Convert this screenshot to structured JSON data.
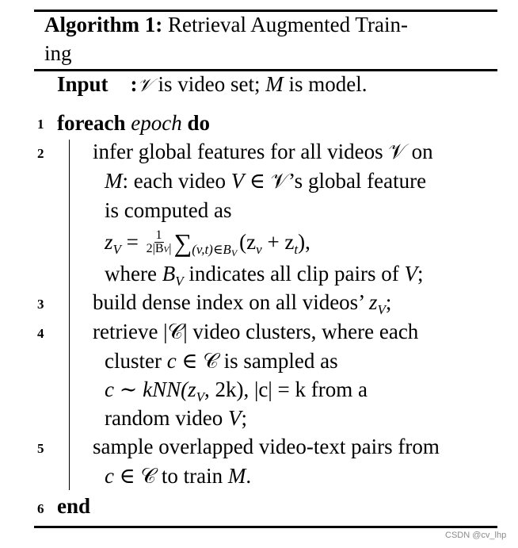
{
  "algorithm": {
    "label": "Algorithm 1:",
    "title_line1": "Retrieval Augmented Train-",
    "title_line2": "ing",
    "input_label": "Input",
    "input_sep": ":",
    "input_text": {
      "v_set": "𝒱",
      "part1": " is video set; ",
      "M": "M",
      "part2": " is model."
    }
  },
  "lines": [
    {
      "num": "1",
      "kw1": "foreach",
      "var": "epoch",
      "kw2": "do"
    },
    {
      "num": "2",
      "l1": "infer global features for all videos 𝒱 on",
      "l2_M": "M",
      "l2": ": each video ",
      "l2_V": "V",
      "l2_b": " ∈ 𝒱’s global feature",
      "l3": "is computed as",
      "formula_lhs": "z",
      "formula_lhs_sub": "V",
      "formula_eq": " = ",
      "frac_num": "1",
      "frac_den": "2|B",
      "frac_den_sub": "V",
      "frac_den_end": "|",
      "sum_sym": "∑",
      "sum_sub": "(v,t)∈B",
      "sum_sub2": "V",
      "formula_rhs": "(z",
      "rhs_sub1": "v",
      "rhs_plus": " + z",
      "rhs_sub2": "t",
      "rhs_end": "),",
      "l5_a": "where ",
      "l5_B": "B",
      "l5_Bsub": "V",
      "l5_b": " indicates all clip pairs of ",
      "l5_V": "V",
      "l5_c": ";"
    },
    {
      "num": "3",
      "text": "build dense index on all videos’ ",
      "z": "z",
      "zsub": "V",
      "end": ";"
    },
    {
      "num": "4",
      "l1": "retrieve |𝒞| video clusters, where each",
      "l2_a": "cluster ",
      "l2_c": "c",
      "l2_b": " ∈ 𝒞 is sampled as",
      "l3": "c ∼ kNN(z",
      "l3_sub": "V",
      "l3_b": ", 2k), |c| = k from a",
      "l4_a": "random video ",
      "l4_V": "V",
      "l4_b": ";"
    },
    {
      "num": "5",
      "l1": "sample overlapped video-text pairs from",
      "l2_c": "c",
      "l2_a": " ∈ 𝒞 to train ",
      "l2_M": "M",
      "l2_b": "."
    },
    {
      "num": "6",
      "kw": "end"
    }
  ],
  "watermark": "CSDN @cv_lhp"
}
